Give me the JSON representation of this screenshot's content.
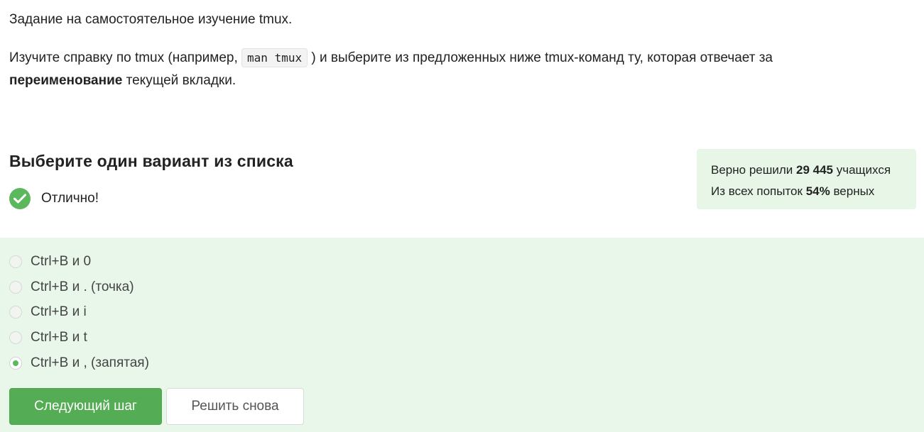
{
  "task": {
    "title": "Задание на самостоятельное изучение tmux.",
    "text_before_code": "Изучите справку по tmux (например, ",
    "code": "man tmux",
    "text_after_code": ") и выберите из предложенных ниже tmux-команд ту, которая отвечает за",
    "bold_word": "переименование",
    "text_end": " текущей вкладки."
  },
  "quiz": {
    "heading": "Выберите один вариант из списка",
    "result_text": "Отлично!",
    "result_icon": "check-circle-icon",
    "options": [
      {
        "label": "Ctrl+B и 0",
        "selected": false
      },
      {
        "label": "Ctrl+B и . (точка)",
        "selected": false
      },
      {
        "label": "Ctrl+B и i",
        "selected": false
      },
      {
        "label": "Ctrl+B и t",
        "selected": false
      },
      {
        "label": "Ctrl+B и , (запятая)",
        "selected": true
      }
    ]
  },
  "stats": {
    "line1_prefix": "Верно решили ",
    "solved_count": "29 445",
    "line1_suffix": " учащихся",
    "line2_prefix": "Из всех попыток ",
    "percent": "54%",
    "line2_suffix": " верных"
  },
  "buttons": {
    "next_label": "Следующий шаг",
    "retry_label": "Решить снова"
  },
  "colors": {
    "accent_green": "#54ad54",
    "panel_green": "#e9f7ea",
    "stats_green": "#e7f6e7"
  }
}
